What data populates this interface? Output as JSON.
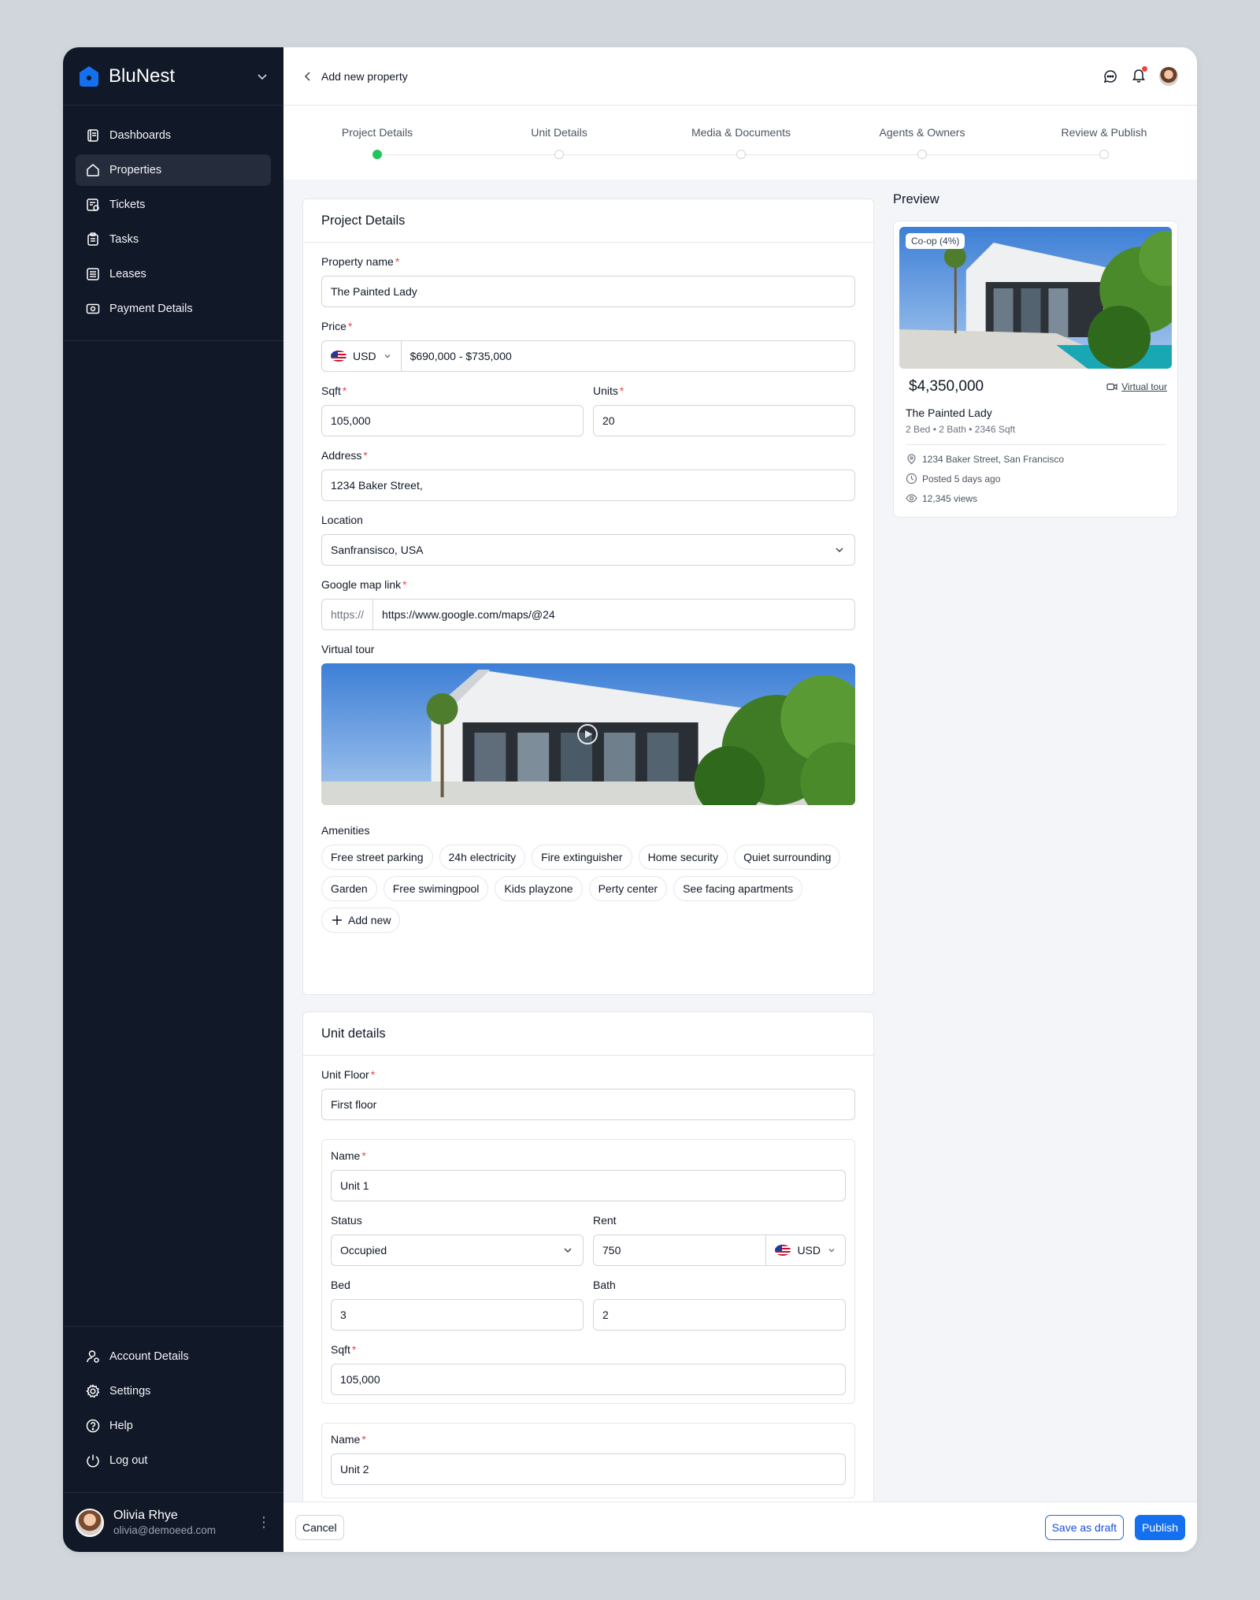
{
  "brand": {
    "name": "BluNest"
  },
  "nav": [
    {
      "label": "Dashboards",
      "icon": "dashboard-icon"
    },
    {
      "label": "Properties",
      "icon": "home-icon"
    },
    {
      "label": "Tickets",
      "icon": "ticket-icon"
    },
    {
      "label": "Tasks",
      "icon": "clipboard-icon"
    },
    {
      "label": "Leases",
      "icon": "document-icon"
    },
    {
      "label": "Payment Details",
      "icon": "payment-icon"
    }
  ],
  "nav_bottom": [
    {
      "label": "Account Details",
      "icon": "user-icon"
    },
    {
      "label": "Settings",
      "icon": "gear-icon"
    },
    {
      "label": "Help",
      "icon": "help-icon"
    },
    {
      "label": "Log out",
      "icon": "power-icon"
    }
  ],
  "user": {
    "name": "Olivia Rhye",
    "email": "olivia@demoeed.com"
  },
  "topbar": {
    "back_label": "Add new property"
  },
  "steps": [
    "Project Details",
    "Unit Details",
    "Media & Documents",
    "Agents & Owners",
    "Review & Publish"
  ],
  "project": {
    "title": "Project Details",
    "property_name_label": "Property name",
    "property_name": "The Painted Lady",
    "price_label": "Price",
    "currency": "USD",
    "price": "$690,000 - $735,000",
    "sqft_label": "Sqft",
    "sqft": "105,000",
    "units_label": "Units",
    "units": "20",
    "address_label": "Address",
    "address": "1234 Baker Street,",
    "location_label": "Location",
    "location": "Sanfransisco, USA",
    "map_label": "Google map link",
    "map_prefix": "https://",
    "map_link": "https://www.google.com/maps/@24",
    "tour_label": "Virtual tour",
    "amenities_label": "Amenities",
    "amenities": [
      "Free street parking",
      "24h electricity",
      "Fire extinguisher",
      "Home security",
      "Quiet surrounding",
      "Garden",
      "Free swimingpool",
      "Kids playzone",
      "Perty center",
      "See facing apartments"
    ],
    "add_new": "Add new"
  },
  "units_section": {
    "title": "Unit details",
    "floor_label": "Unit Floor",
    "floor": "First floor",
    "unit1": {
      "name_label": "Name",
      "name": "Unit 1",
      "status_label": "Status",
      "status": "Occupied",
      "rent_label": "Rent",
      "rent": "750",
      "rent_currency": "USD",
      "bed_label": "Bed",
      "bed": "3",
      "bath_label": "Bath",
      "bath": "2",
      "sqft_label": "Sqft",
      "sqft": "105,000"
    },
    "unit2": {
      "name_label": "Name",
      "name": "Unit 2"
    }
  },
  "preview": {
    "title": "Preview",
    "badge": "Co-op (4%)",
    "price": "$4,350,000",
    "virtual_tour": "Virtual tour",
    "name": "The Painted Lady",
    "meta": "2 Bed • 2 Bath • 2346 Sqft",
    "address": "1234 Baker Street,  San Francisco",
    "posted": "Posted 5 days ago",
    "views": "12,345 views"
  },
  "footer": {
    "cancel": "Cancel",
    "draft": "Save as draft",
    "publish": "Publish"
  },
  "colors": {
    "sidebar": "#111827",
    "accent": "#1570ef",
    "active_step": "#22c55e",
    "required": "#ef4444"
  }
}
